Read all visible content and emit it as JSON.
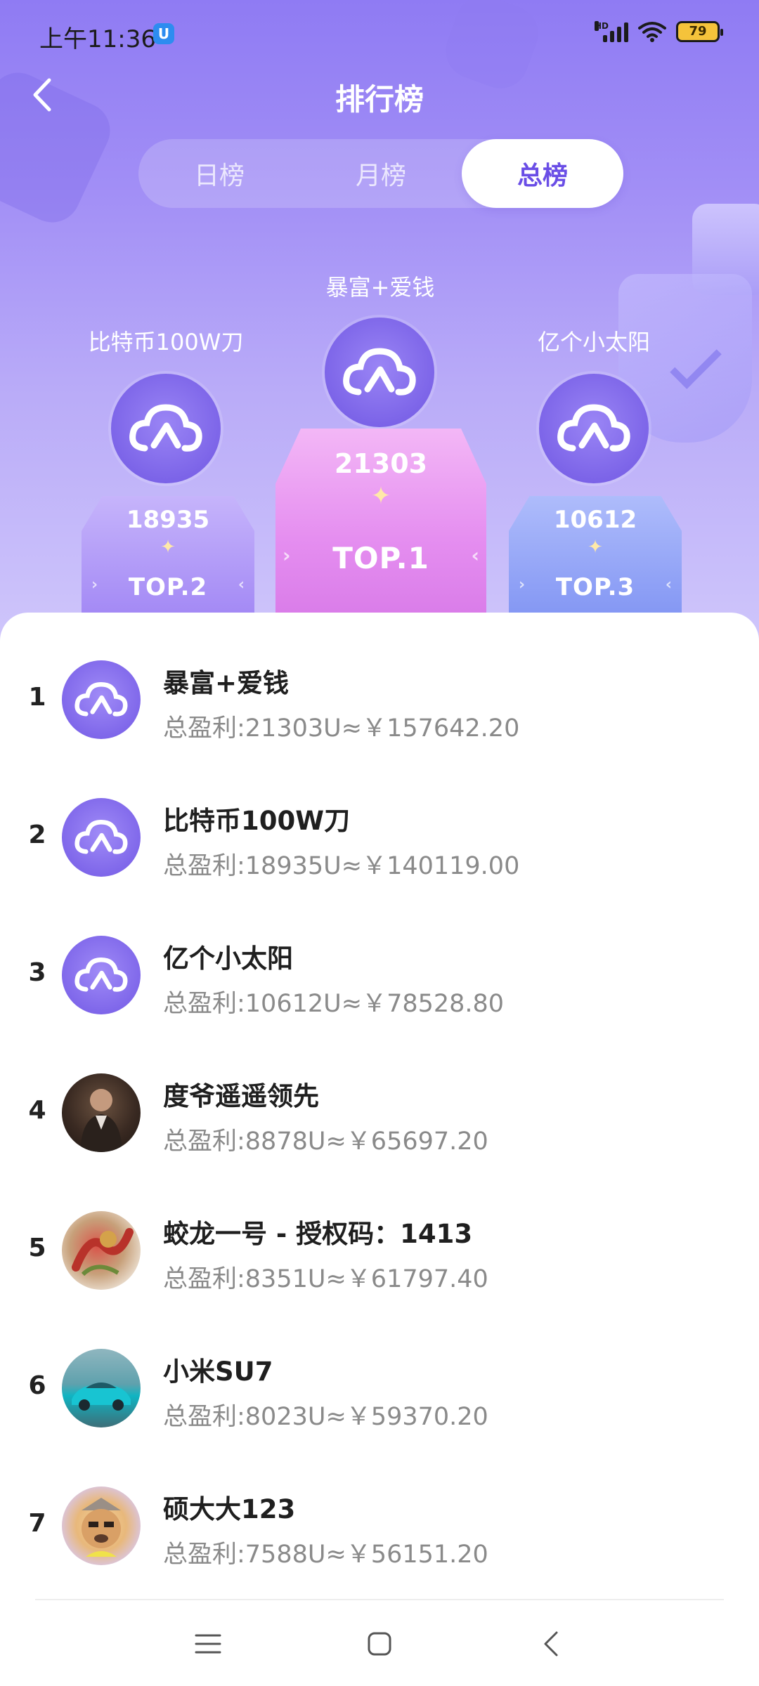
{
  "status_bar": {
    "time": "上午11:36",
    "app_badge": "U",
    "network": "HD",
    "battery": "79"
  },
  "header": {
    "title": "排行榜"
  },
  "tabs": [
    {
      "label": "日榜",
      "active": false
    },
    {
      "label": "月榜",
      "active": false
    },
    {
      "label": "总榜",
      "active": true
    }
  ],
  "podium": {
    "first": {
      "name": "暴富+爱钱",
      "score": "21303",
      "label": "TOP.1"
    },
    "second": {
      "name": "比特币100W刀",
      "score": "18935",
      "label": "TOP.2"
    },
    "third": {
      "name": "亿个小太阳",
      "score": "10612",
      "label": "TOP.3"
    }
  },
  "ranking": [
    {
      "rank": "1",
      "name": "暴富+爱钱",
      "profit": "总盈利:21303U≈￥157642.20",
      "avatar": "cloud-logo"
    },
    {
      "rank": "2",
      "name": "比特币100W刀",
      "profit": "总盈利:18935U≈￥140119.00",
      "avatar": "cloud-logo"
    },
    {
      "rank": "3",
      "name": "亿个小太阳",
      "profit": "总盈利:10612U≈￥78528.80",
      "avatar": "cloud-logo"
    },
    {
      "rank": "4",
      "name": "度爷遥遥领先",
      "profit": "总盈利:8878U≈￥65697.20",
      "avatar": "photo-person"
    },
    {
      "rank": "5",
      "name": "蛟龙一号 - 授权码：1413",
      "profit": "总盈利:8351U≈￥61797.40",
      "avatar": "photo-dragon"
    },
    {
      "rank": "6",
      "name": "小米SU7",
      "profit": "总盈利:8023U≈￥59370.20",
      "avatar": "photo-car"
    },
    {
      "rank": "7",
      "name": "硕大大123",
      "profit": "总盈利:7588U≈￥56151.20",
      "avatar": "photo-cartoon-dog"
    }
  ],
  "colors": {
    "accent": "#6a4ee6",
    "hero_top": "#8f7bf3",
    "top1_block": "#e995f2",
    "top2_block": "#b49cf7",
    "top3_block": "#8d9ff7"
  },
  "nav": {
    "menu_icon": "menu-icon",
    "home_icon": "home-icon",
    "back_icon": "back-icon"
  }
}
